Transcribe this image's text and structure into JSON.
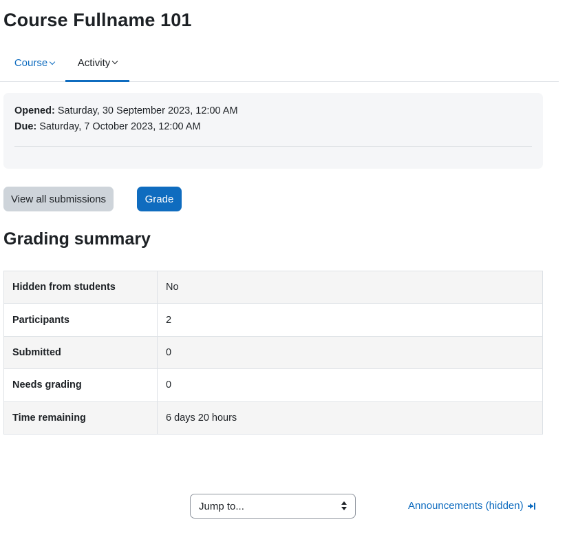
{
  "page": {
    "title": "Course Fullname 101"
  },
  "nav": {
    "tabs": [
      {
        "label": "Course",
        "active": false
      },
      {
        "label": "Activity",
        "active": true
      }
    ]
  },
  "dates": {
    "opened_label": "Opened:",
    "opened_value": "Saturday, 30 September 2023, 12:00 AM",
    "due_label": "Due:",
    "due_value": "Saturday, 7 October 2023, 12:00 AM"
  },
  "actions": {
    "view_all_label": "View all submissions",
    "grade_label": "Grade"
  },
  "grading_summary": {
    "title": "Grading summary",
    "rows": [
      {
        "label": "Hidden from students",
        "value": "No"
      },
      {
        "label": "Participants",
        "value": "2"
      },
      {
        "label": "Submitted",
        "value": "0"
      },
      {
        "label": "Needs grading",
        "value": "0"
      },
      {
        "label": "Time remaining",
        "value": "6 days 20 hours"
      }
    ]
  },
  "footer": {
    "jump_selected": "Jump to...",
    "next_activity_label": "Announcements (hidden)"
  },
  "colors": {
    "primary": "#0f6cbf",
    "secondary_button": "#ced4da",
    "panel_bg": "#f5f6f8",
    "text": "#1d2125"
  }
}
